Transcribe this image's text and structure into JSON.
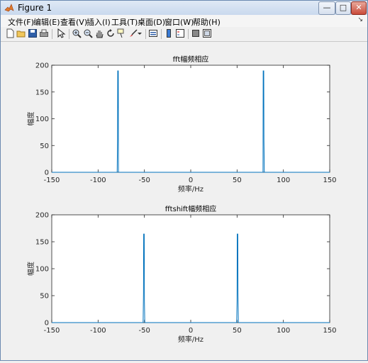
{
  "window": {
    "title": "Figure 1",
    "controls": {
      "minimize": "—",
      "maximize": "□",
      "close": "✕"
    }
  },
  "menubar": {
    "items": [
      "文件(F)",
      "编辑(E)",
      "查看(V)",
      "插入(I)",
      "工具(T)",
      "桌面(D)",
      "窗口(W)",
      "帮助(H)"
    ],
    "overflow_arrow": "↘"
  },
  "toolbar": {
    "icons": [
      "new-figure-icon",
      "open-file-icon",
      "save-icon",
      "print-icon",
      "pointer-icon",
      "zoom-in-icon",
      "zoom-out-icon",
      "pan-icon",
      "rotate-icon",
      "data-cursor-icon",
      "brush-icon",
      "link-plot-icon",
      "colorbar-icon",
      "legend-icon",
      "hide-plot-tools-icon",
      "show-plot-tools-icon"
    ]
  },
  "chart_data": [
    {
      "type": "line",
      "title": "fft幅频相应",
      "xlabel": "频率/Hz",
      "ylabel": "幅度",
      "xlim": [
        -150,
        150
      ],
      "ylim": [
        0,
        200
      ],
      "xticks": [
        -150,
        -100,
        -50,
        0,
        50,
        100,
        150
      ],
      "yticks": [
        0,
        50,
        100,
        150,
        200
      ],
      "color": "#0072bd",
      "series": [
        {
          "x": [
            -150,
            -80,
            -79.4,
            -79,
            -78.8,
            -78.5,
            -78.2,
            -78,
            -77.6,
            -77,
            77,
            77.6,
            78,
            78.2,
            78.5,
            78.8,
            79,
            79.4,
            80,
            150
          ],
          "y": [
            0,
            0,
            0,
            60,
            190,
            120,
            190,
            0,
            0,
            0,
            0,
            0,
            0,
            190,
            120,
            190,
            60,
            0,
            0,
            0
          ]
        }
      ]
    },
    {
      "type": "line",
      "title": "fftshift幅频相应",
      "xlabel": "频率/Hz",
      "ylabel": "幅度",
      "xlim": [
        -150,
        150
      ],
      "ylim": [
        0,
        200
      ],
      "xticks": [
        -150,
        -100,
        -50,
        0,
        50,
        100,
        150
      ],
      "yticks": [
        0,
        50,
        100,
        150,
        200
      ],
      "color": "#0072bd",
      "series": [
        {
          "x": [
            -150,
            -52,
            -51.4,
            -51,
            -50.8,
            -50.5,
            -50.2,
            -50,
            -49.6,
            -49,
            49,
            49.6,
            50,
            50.2,
            50.5,
            50.8,
            51,
            51.4,
            52,
            150
          ],
          "y": [
            0,
            0,
            0,
            55,
            165,
            135,
            165,
            40,
            0,
            0,
            0,
            0,
            40,
            165,
            135,
            165,
            55,
            0,
            0,
            0
          ]
        }
      ]
    }
  ]
}
